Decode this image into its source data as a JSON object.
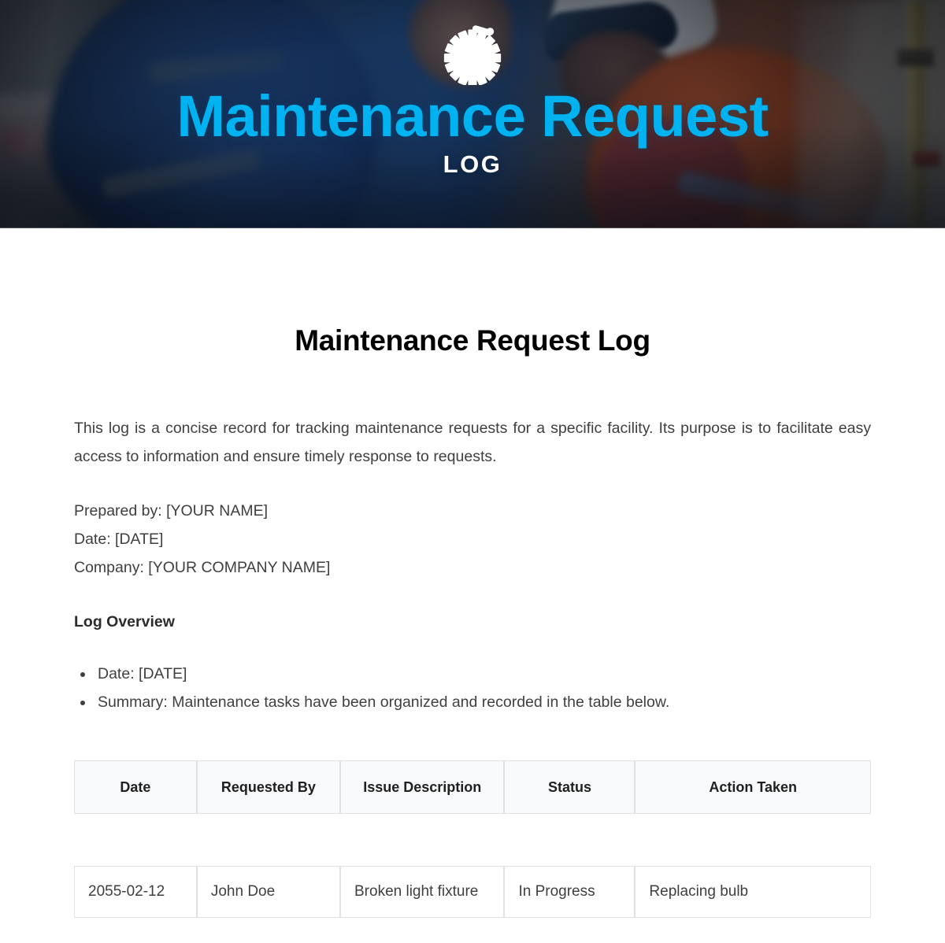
{
  "banner": {
    "icon": "gear-valve-icon",
    "title": "Maintenance Request",
    "subtitle": "LOG",
    "title_color": "#00b3f0",
    "subtitle_color": "#ffffff"
  },
  "document": {
    "title": "Maintenance Request Log",
    "intro": "This log is a concise record for tracking maintenance requests for a specific facility. Its purpose is to facilitate easy access to information and ensure timely response to requests.",
    "meta": {
      "prepared_by": "Prepared by: [YOUR NAME]",
      "date": "Date: [DATE]",
      "company": "Company: [YOUR COMPANY NAME]"
    },
    "overview": {
      "heading": "Log Overview",
      "bullets": [
        "Date: [DATE]",
        "Summary: Maintenance tasks have been organized and recorded in the table below."
      ]
    },
    "table": {
      "columns": [
        "Date",
        "Requested By",
        "Issue Description",
        "Status",
        "Action Taken"
      ],
      "rows": [
        {
          "date": "2055-02-12",
          "requested_by": "John Doe",
          "issue": "Broken light fixture",
          "status": "In Progress",
          "action": "Replacing bulb"
        }
      ]
    }
  }
}
